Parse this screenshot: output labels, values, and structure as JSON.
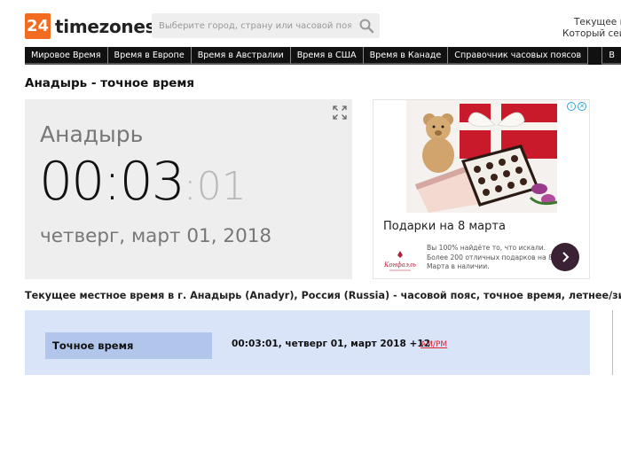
{
  "logo": {
    "badge": "24",
    "text": "timezones"
  },
  "search": {
    "placeholder": "Выберите город, страну или часовой пояс"
  },
  "header_right": {
    "line1": "Текущее вр",
    "line2": "Который сейча"
  },
  "nav": {
    "items": [
      "Мировое Время",
      "Время в Европе",
      "Время в Австралии",
      "Время в США",
      "Время в Канаде",
      "Справочник часовых поясов"
    ],
    "last": "В"
  },
  "page_title": "Анадырь - точное время",
  "clock": {
    "city": "Анадырь",
    "time_main": "00:03",
    "time_seconds": ":01",
    "date": "четверг, март 01, 2018"
  },
  "ad": {
    "headline": "Подарки на 8 марта",
    "description": "Вы 100% найдёте то, что искали. Более 200 отличных подарков на 8 Марта в наличии.",
    "brand": "Конфаэль"
  },
  "subtitle": "Текущее местное время в г. Анадырь (Anadyr), Россия (Russia) - часовой пояс, точное время, летнее/зимнее вр",
  "info": {
    "label": "Точное время",
    "value": "00:03:01, четверг 01, март 2018 +12",
    "ampm": "AM/PM"
  },
  "colors": {
    "brand": "#f26b21",
    "nav_bg": "#111111",
    "info_bg": "#d9e4f8",
    "info_label_bg": "#b2c6ec",
    "link_red": "#dd2233"
  }
}
